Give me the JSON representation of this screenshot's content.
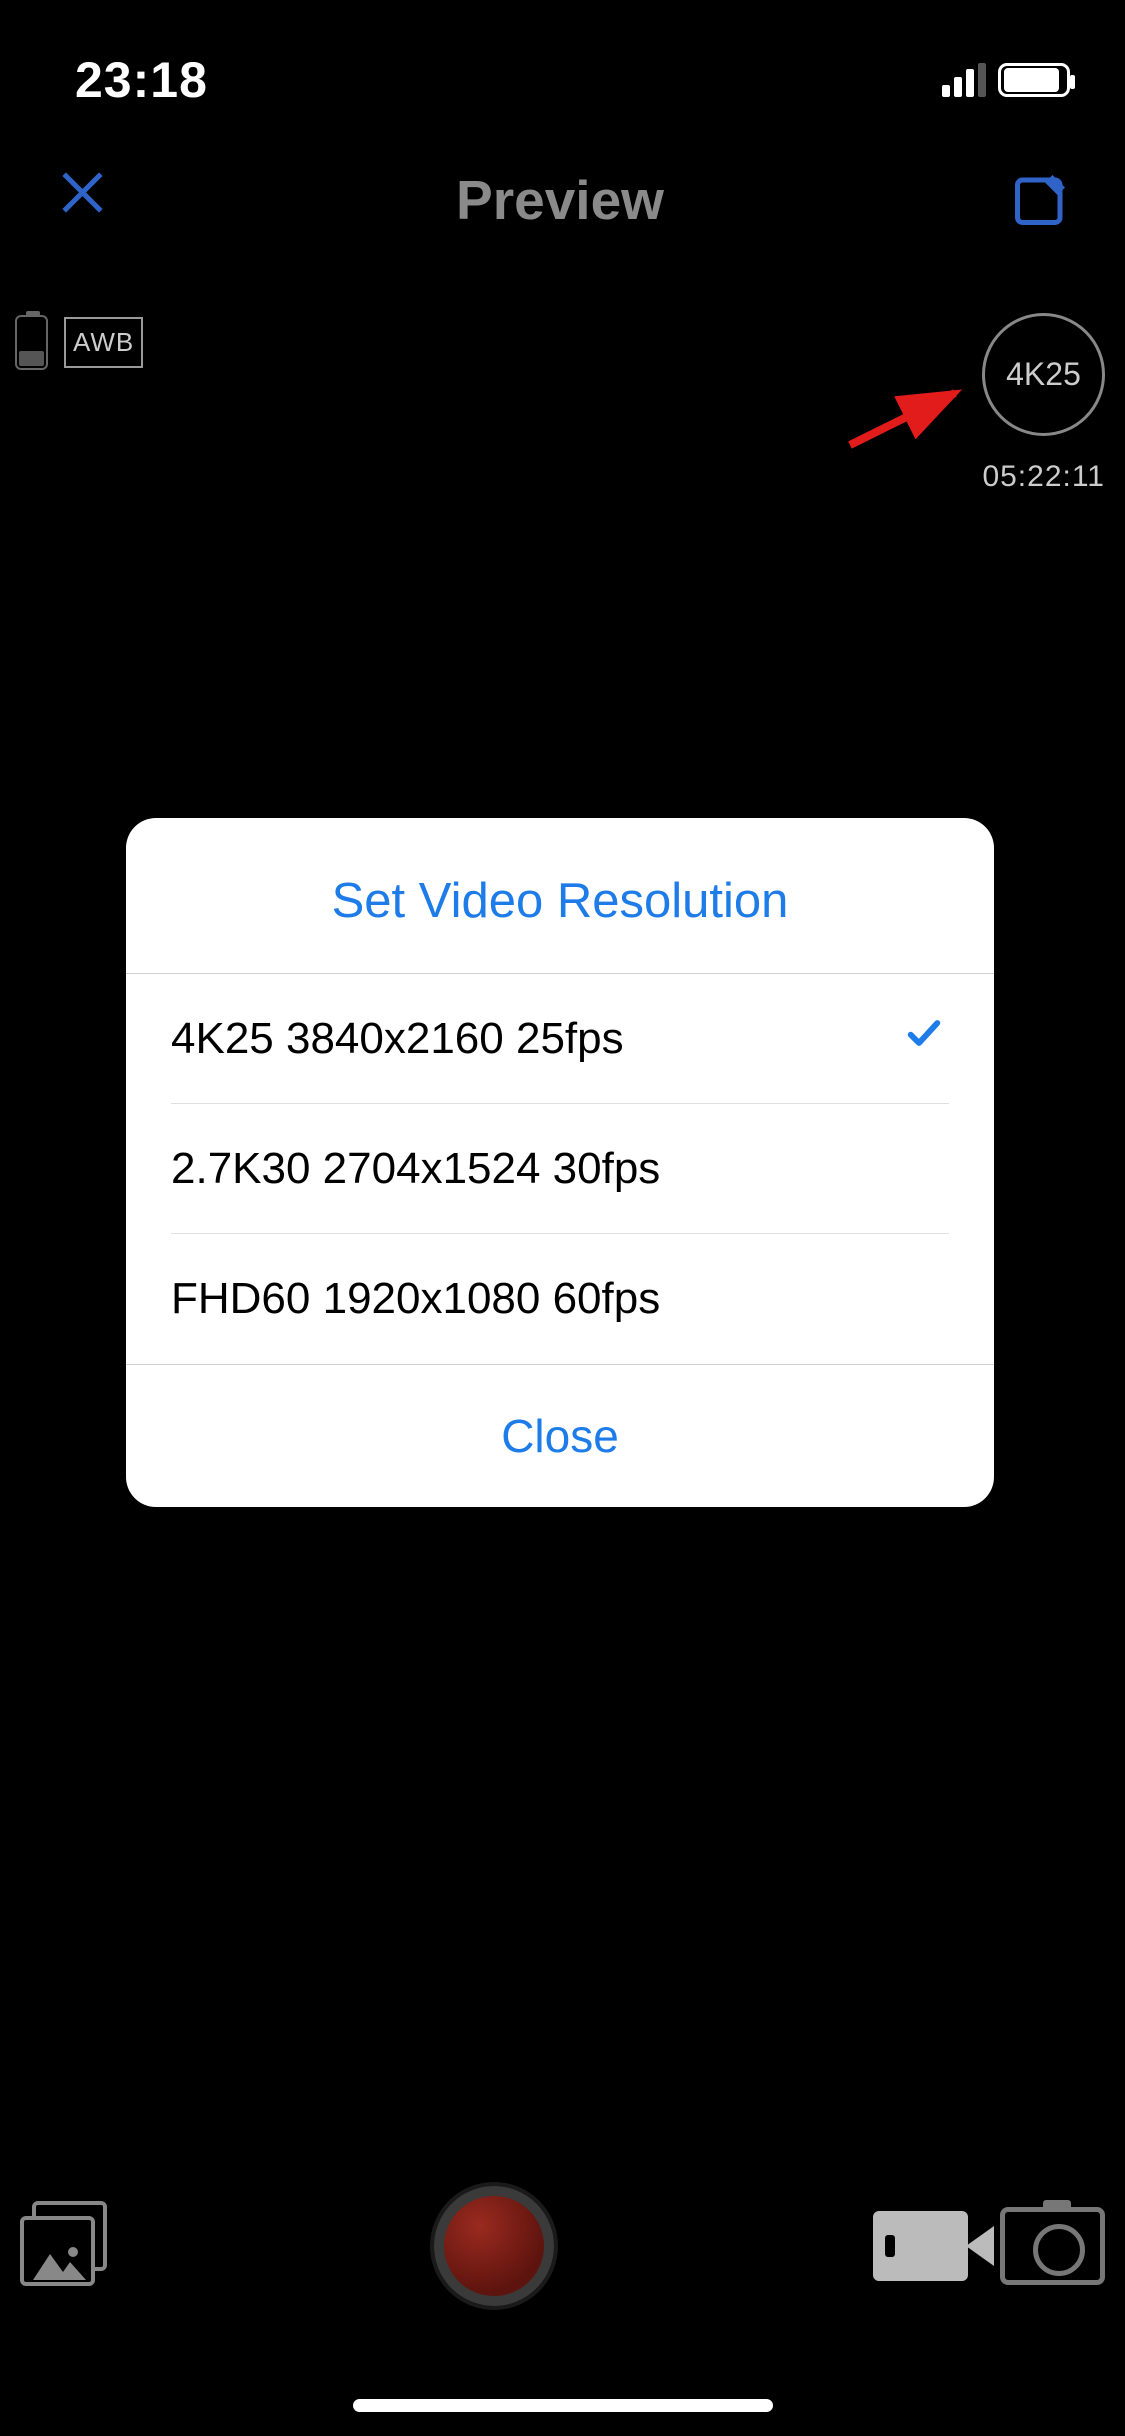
{
  "status": {
    "time": "23:18"
  },
  "nav": {
    "title": "Preview"
  },
  "indicators": {
    "awb": "AWB"
  },
  "resolution": {
    "badge": "4K25",
    "rec_time": "05:22:11"
  },
  "modal": {
    "title": "Set Video Resolution",
    "options": [
      {
        "label": "4K25 3840x2160 25fps",
        "selected": true
      },
      {
        "label": "2.7K30 2704x1524 30fps",
        "selected": false
      },
      {
        "label": "FHD60 1920x1080 60fps",
        "selected": false
      }
    ],
    "close": "Close"
  },
  "colors": {
    "accent": "#1E7CE9",
    "annotation": "#E21B1B"
  }
}
